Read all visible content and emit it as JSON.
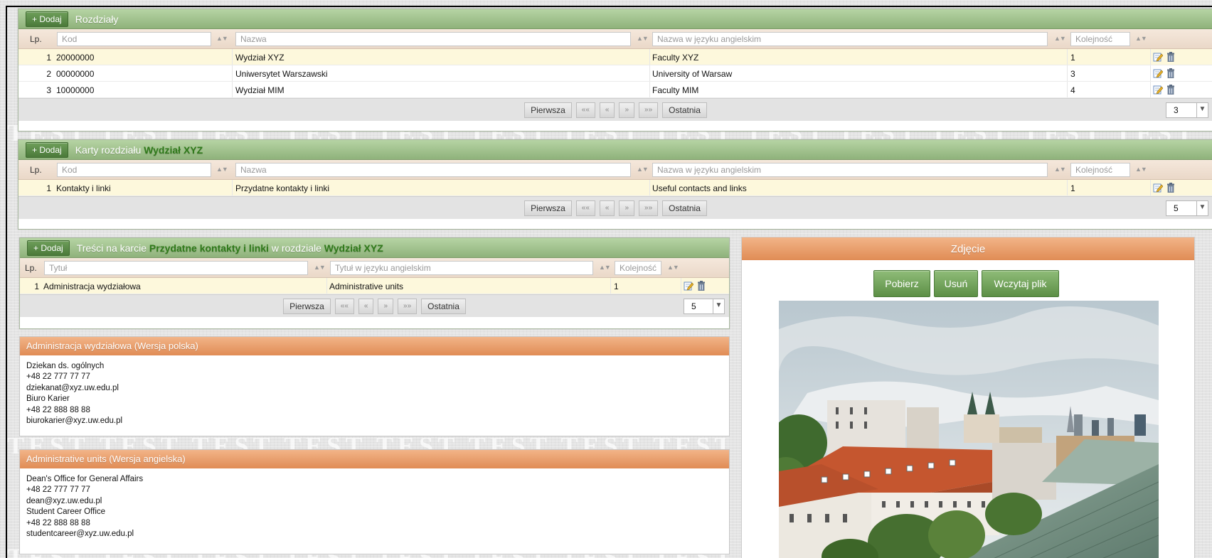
{
  "rozdzialy": {
    "add_label": "+ Dodaj",
    "title": "Rozdziały",
    "filters": {
      "lp": "Lp.",
      "kod": "Kod",
      "nazwa": "Nazwa",
      "nazwa_en": "Nazwa w języku angielskim",
      "kolejnosc": "Kolejność"
    },
    "rows": [
      {
        "lp": "1",
        "kod": "20000000",
        "nazwa": "Wydział XYZ",
        "nazwa_en": "Faculty XYZ",
        "kolejnosc": "1"
      },
      {
        "lp": "2",
        "kod": "00000000",
        "nazwa": "Uniwersytet Warszawski",
        "nazwa_en": "University of Warsaw",
        "kolejnosc": "3"
      },
      {
        "lp": "3",
        "kod": "10000000",
        "nazwa": "Wydział MIM",
        "nazwa_en": "Faculty MIM",
        "kolejnosc": "4"
      }
    ],
    "page_size": "3"
  },
  "karty": {
    "add_label": "+ Dodaj",
    "title_prefix": "Karty rozdziału",
    "title_hl": "Wydział XYZ",
    "filters": {
      "lp": "Lp.",
      "kod": "Kod",
      "nazwa": "Nazwa",
      "nazwa_en": "Nazwa w języku angielskim",
      "kolejnosc": "Kolejność"
    },
    "rows": [
      {
        "lp": "1",
        "kod": "Kontakty i linki",
        "nazwa": "Przydatne kontakty i linki",
        "nazwa_en": "Useful contacts and links",
        "kolejnosc": "1"
      }
    ],
    "page_size": "5"
  },
  "tresci": {
    "add_label": "+ Dodaj",
    "title_prefix": "Treści na karcie",
    "title_hl1": "Przydatne kontakty i linki",
    "title_mid": "w rozdziale",
    "title_hl2": "Wydział XYZ",
    "filters": {
      "lp": "Lp.",
      "tytul": "Tytuł",
      "tytul_en": "Tytuł w języku angielskim",
      "kolejnosc": "Kolejność"
    },
    "rows": [
      {
        "lp": "1",
        "tytul": "Administracja wydziałowa",
        "tytul_en": "Administrative units",
        "kolejnosc": "1"
      }
    ],
    "page_size": "5"
  },
  "pager": {
    "first": "Pierwsza",
    "ff": "««",
    "prev": "«",
    "next": "»",
    "fn": "»»",
    "last": "Ostatnia"
  },
  "pl_panel": {
    "title": "Administracja wydziałowa (Wersja polska)",
    "lines": [
      "Dziekan ds. ogólnych",
      "+48 22 777 77 77",
      "dziekanat@xyz.uw.edu.pl",
      "Biuro Karier",
      "+48 22 888 88 88",
      "biurokarier@xyz.uw.edu.pl"
    ]
  },
  "en_panel": {
    "title": "Administrative units (Wersja angielska)",
    "lines": [
      "Dean's Office for General Affairs",
      "+48 22 777 77 77",
      "dean@xyz.uw.edu.pl",
      "Student Career Office",
      "+48 22 888 88 88",
      "studentcareer@xyz.uw.edu.pl"
    ]
  },
  "zdjecie": {
    "title": "Zdjęcie",
    "download": "Pobierz",
    "delete": "Usuń",
    "upload": "Wczytaj plik"
  },
  "watermark": "TEST",
  "colors": {
    "green_header": "#8fb27b",
    "orange_header": "#e08c55",
    "highlight": "#2f7a1a",
    "selected_row": "#fdf8dc"
  }
}
